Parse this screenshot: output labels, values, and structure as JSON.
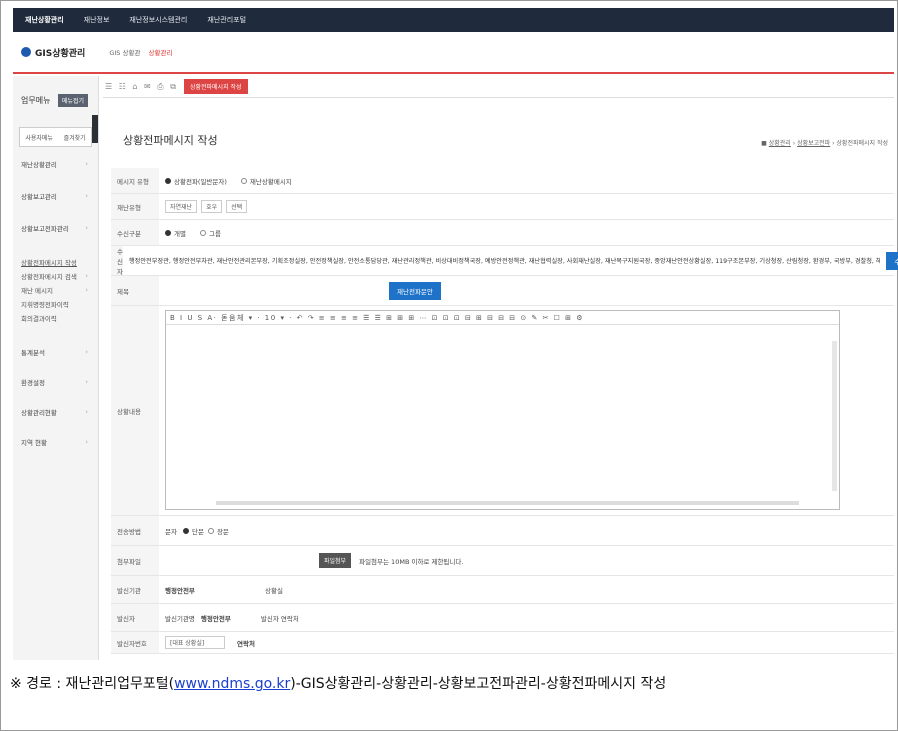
{
  "topnav": [
    "재난상황관리",
    "재난정보",
    "재난정보시스템관리",
    "재난관리포털"
  ],
  "header": {
    "app_name": "GIS상황관리",
    "crumb": "GIS 상황관",
    "crumb_current": "상황관리"
  },
  "sidebar": {
    "title": "업무메뉴",
    "collapse_btn": "메뉴접기",
    "tabs": [
      "사용자메뉴",
      "즐겨찾기"
    ],
    "items": [
      {
        "label": "재난상황관리",
        "chev": "›",
        "active": false
      },
      {
        "label": "상황보고관리",
        "chev": "›",
        "active": false
      },
      {
        "label": "상황보고전파관리",
        "chev": "›",
        "active": false
      },
      {
        "label": "상황전파메시지 작성",
        "chev": "",
        "active": true
      },
      {
        "label": "상황전파메시지 검색",
        "chev": "›",
        "active": false
      },
      {
        "label": "재난 메시지",
        "chev": "›",
        "active": false
      },
      {
        "label": "지휘명령전파이력",
        "chev": "",
        "active": false
      },
      {
        "label": "회의결과이력",
        "chev": "",
        "active": false
      },
      {
        "label": "통계분석",
        "chev": "›",
        "active": false
      },
      {
        "label": "환경설정",
        "chev": "›",
        "active": false
      },
      {
        "label": "상황관리현황",
        "chev": "›",
        "active": false
      },
      {
        "label": "지역 현황",
        "chev": "›",
        "active": false
      }
    ]
  },
  "toolbar": {
    "icons": "☰ ☷ ⌂ ✉ ⎙ ⧉",
    "active_tab": "상황전파메시지 작성"
  },
  "page": {
    "title": "상황전파메시지 작성",
    "crumb": [
      "상황관리",
      "상황보고전파",
      "상황전파메시지 작성"
    ]
  },
  "form": {
    "msg_type_label": "메시지 유형",
    "msg_type_options": [
      "상황전파(일반문자)",
      "재난상황메시지"
    ],
    "disaster_type_label": "재난유형",
    "disaster_type_values": [
      "자연재난",
      "호우",
      "선택"
    ],
    "send_type_label": "수신구분",
    "send_type_options": [
      "개별",
      "그룹"
    ],
    "receiver_label": "수신자",
    "receivers": "행정안전부장관, 행정안전부차관, 재난안전관리본부장, 기획조정실장, 안전정책실장, 안전소통담당관, 재난관리정책관, 비상대비정책국장, 예방안전정책관, 재난협력실장, 사회재난실장, 재난복구지원국장, 중앙재난안전상황실장, 119구조본부장, 기상청장, 산림청장, 환경부, 국방부, 경찰청, 해양경찰청",
    "receiver_btn": "수신자선택",
    "subject_label": "제목",
    "subject_btn": "재난전파문안",
    "editor_tools": "B I U S A· 돋움체 ▾ · 10 ▾ · ↶ ↷ ≡ ≡ ≡ ≡ ☰ ☰ ⊞ ⊞ ⊞ ⋯ ⊡ ⊡ ⊡ ⊟ ⊞ ⊟ ⊟ ⊟ ⊙ ✎ ✂ ☐ ⊞ ⚙",
    "content_label": "상황내용",
    "send_method_label": "전송방법",
    "send_method_prefix": "문자",
    "send_method_options": [
      "단문",
      "장문"
    ],
    "attach_label": "첨부파일",
    "attach_btn": "파일첨부",
    "attach_note": "파일첨부는 10MB 이하로 제한됩니다.",
    "sender_org_label": "발신기관",
    "sender_org_value": "행정안전부",
    "sender_contact": "상황실",
    "sender_name_label": "발신자",
    "sender_name_prefix": "발신기관명",
    "sender_name_value": "행정안전부",
    "sender_name_suffix": "발신자 연락처",
    "sender_phone_label": "발신자번호",
    "sender_phone_value": "[대표 상황실]",
    "sender_phone_sub": "연락처"
  },
  "caption": {
    "prefix": "※ 경로 : 재난관리업무포털(",
    "link": "www.ndms.go.kr",
    "suffix": ")-GIS상황관리-상황관리-상황보고전파관리-상황전파메시지 작성"
  }
}
